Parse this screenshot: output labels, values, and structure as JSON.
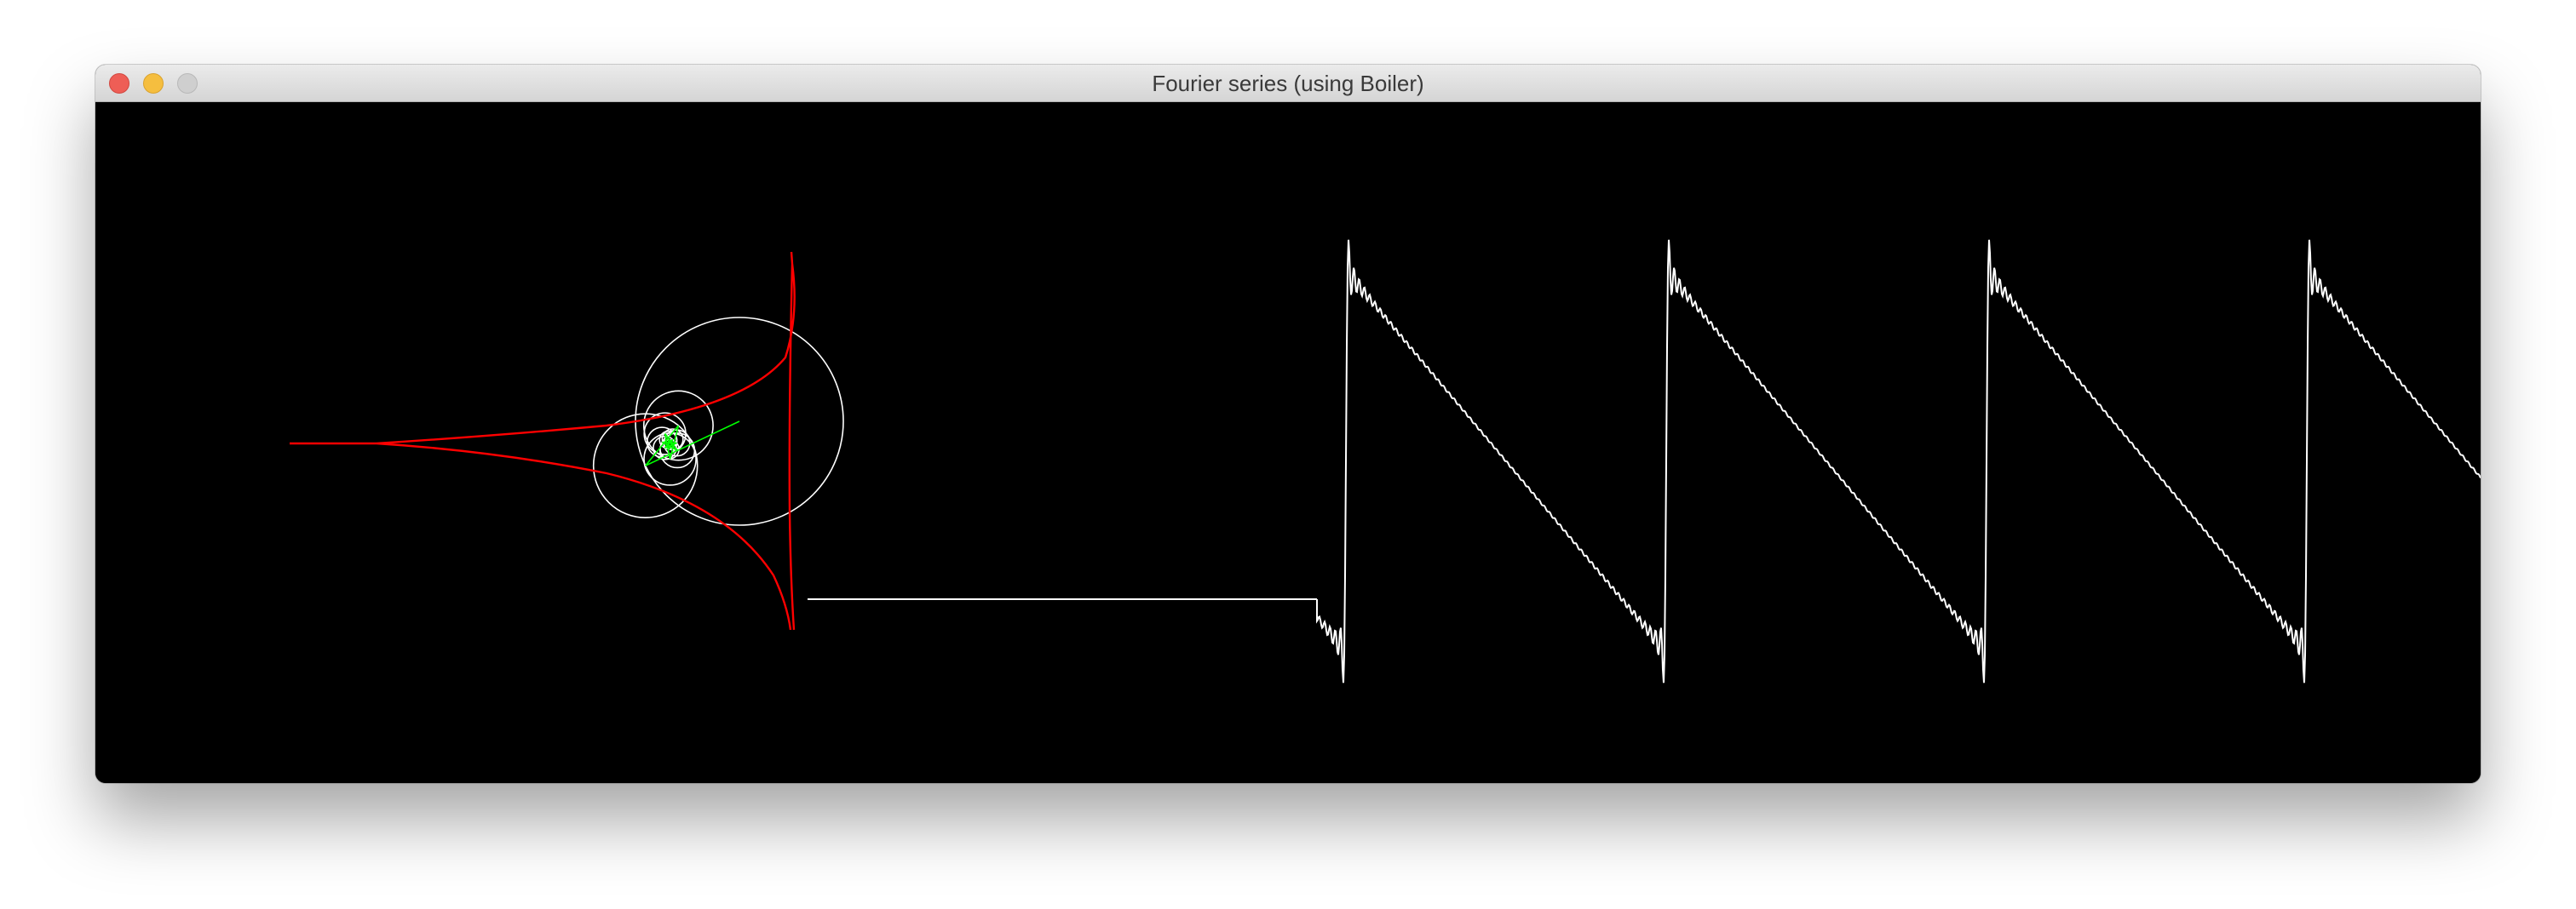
{
  "window": {
    "title": "Fourier series (using Boiler)"
  },
  "controls": {
    "close_icon": "close-icon",
    "minimize_icon": "minimize-icon",
    "zoom_icon": "zoom-icon"
  },
  "colors": {
    "background": "#000000",
    "circles": "#ffffff",
    "traced_path": "#ff0000",
    "radius_vectors": "#00ff00",
    "waveform": "#ffffff"
  },
  "simulation": {
    "waveform_type": "sawtooth",
    "visible_harmonics": 12
  }
}
